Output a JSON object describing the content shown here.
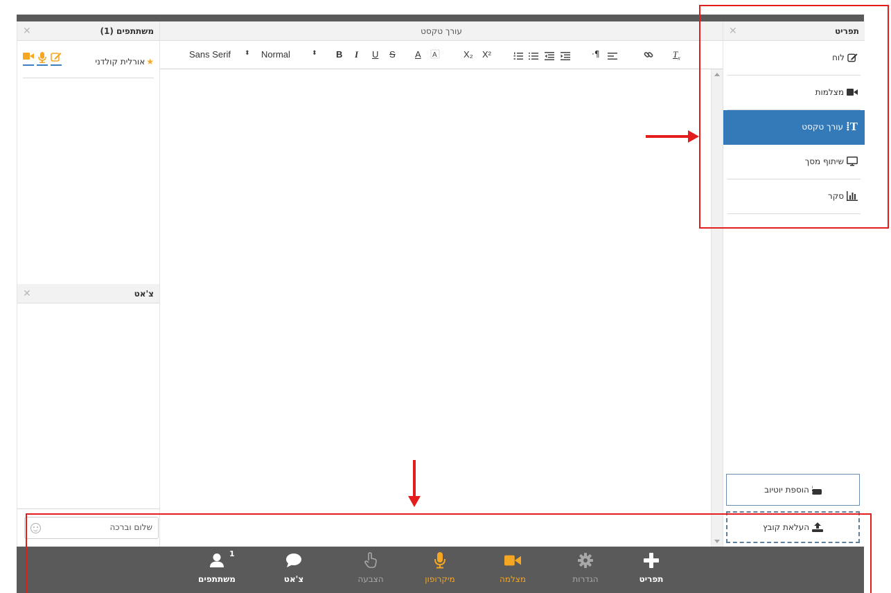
{
  "participants_panel": {
    "title": "משתתפים (1)",
    "close": "✕",
    "participant": {
      "star": "★",
      "name": "אורלית קולדני"
    }
  },
  "chat_panel": {
    "title": "צ'אט",
    "close": "✕",
    "input_value": "שלום וברכה"
  },
  "editor": {
    "title": "עורך טקסט",
    "toolbar": {
      "font": "Sans Serif",
      "size": "Normal",
      "bold": "B",
      "italic": "I",
      "underline": "U",
      "strike": "S",
      "color": "A",
      "subscript": "X₂",
      "superscript": "X²"
    }
  },
  "menu_panel": {
    "title": "תפריט",
    "close": "✕",
    "items": [
      {
        "label": "לוח",
        "icon": "edit-icon"
      },
      {
        "label": "מצלמות",
        "icon": "video-camera-icon"
      },
      {
        "label": "עורך טקסט",
        "icon": "text-editor-icon",
        "active": true
      },
      {
        "label": "שיתוף מסך",
        "icon": "monitor-icon"
      },
      {
        "label": "סקר",
        "icon": "bar-chart-icon"
      }
    ],
    "youtube_button": "הוספת יוטיוב",
    "upload_button": "העלאת קובץ"
  },
  "bottom_bar": {
    "participants": {
      "label": "משתתפים",
      "badge": "1"
    },
    "chat": {
      "label": "צ'אט"
    },
    "raise_hand": {
      "label": "הצבעה"
    },
    "microphone": {
      "label": "מיקרופון"
    },
    "camera": {
      "label": "מצלמה"
    },
    "settings": {
      "label": "הגדרות"
    },
    "menu": {
      "label": "תפריט"
    }
  },
  "colors": {
    "accent_blue": "#3479b8",
    "accent_orange": "#f5a623",
    "annotation_red": "#e31c1c",
    "bar_gray": "#5a5a5a"
  }
}
